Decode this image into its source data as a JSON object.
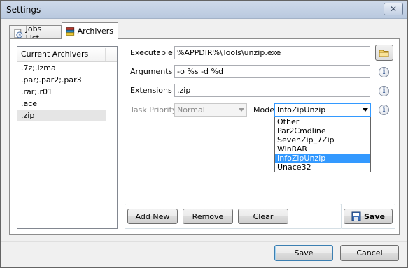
{
  "window": {
    "title": "Settings",
    "close_glyph": "✕"
  },
  "tabs": [
    {
      "label": "Jobs List",
      "icon": "clock-page-icon",
      "active": false
    },
    {
      "label": "Archivers",
      "icon": "archive-icon",
      "active": true
    }
  ],
  "archivers": {
    "header": "Current Archivers",
    "items": [
      ".7z;.lzma",
      ".par;.par2;.par3",
      ".rar;.r01",
      ".ace",
      ".zip"
    ],
    "selected_index": 4
  },
  "form": {
    "executable_label": "Executable",
    "executable_value": "%APPDIR%\\Tools\\unzip.exe",
    "arguments_label": "Arguments",
    "arguments_value": "-o %s -d %d",
    "extensions_label": "Extensions",
    "extensions_value": ".zip",
    "priority_label": "Task Priority",
    "priority_value": "Normal",
    "mode_label": "Mode",
    "mode_value": "InfoZipUnzip",
    "info_glyph": "i"
  },
  "mode_options": [
    "Other",
    "Par2Cmdline",
    "SevenZip_7Zip",
    "WinRAR",
    "InfoZipUnzip",
    "Unace32"
  ],
  "mode_selected_index": 4,
  "buttons": {
    "add_new": "Add New",
    "remove": "Remove",
    "clear": "Clear",
    "save_archiver": "Save",
    "save": "Save",
    "cancel": "Cancel"
  },
  "colors": {
    "selection": "#3399ff",
    "accent_border": "#3399ff"
  }
}
